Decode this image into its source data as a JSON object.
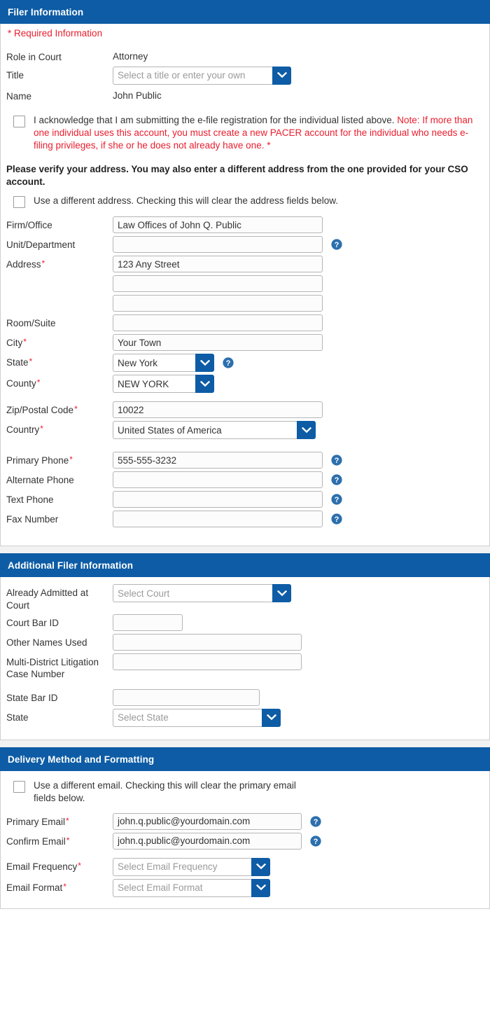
{
  "sections": {
    "filer": {
      "header": "Filer Information",
      "required_note": "* Required Information",
      "role_label": "Role in Court",
      "role_value": "Attorney",
      "title_label": "Title",
      "title_placeholder": "Select a title or enter your own",
      "name_label": "Name",
      "name_value": "John Public",
      "ack_text_1": "I acknowledge that I am submitting the e-file registration for the individual listed above.",
      "ack_text_2": "Note: If more than one individual uses this account, you must create a new PACER account for the individual who needs e-filing privileges, if she or he does not already have one. *",
      "verify_note": "Please verify your address. You may also enter a different address from the one provided for your CSO account.",
      "different_address_text": "Use a different address. Checking this will clear the address fields below.",
      "firm_label": "Firm/Office",
      "firm_value": "Law Offices of John Q. Public",
      "unit_label": "Unit/Department",
      "unit_value": "",
      "address_label": "Address",
      "address_value_1": "123 Any Street",
      "address_value_2": "",
      "address_value_3": "",
      "room_label": "Room/Suite",
      "room_value": "",
      "city_label": "City",
      "city_value": "Your Town",
      "state_label": "State",
      "state_value": "New York",
      "county_label": "County",
      "county_value": "NEW YORK",
      "zip_label": "Zip/Postal Code",
      "zip_value": "10022",
      "country_label": "Country",
      "country_value": "United States of America",
      "primary_phone_label": "Primary Phone",
      "primary_phone_value": "555-555-3232",
      "alternate_phone_label": "Alternate Phone",
      "alternate_phone_value": "",
      "text_phone_label": "Text Phone",
      "text_phone_value": "",
      "fax_label": "Fax Number",
      "fax_value": ""
    },
    "additional": {
      "header": "Additional Filer Information",
      "admitted_label": "Already Admitted at Court",
      "admitted_value": "Select Court",
      "court_bar_label": "Court Bar ID",
      "court_bar_value": "",
      "other_names_label": "Other Names Used",
      "other_names_value": "",
      "mdl_label": "Multi-District Litigation Case Number",
      "mdl_value": "",
      "state_bar_label": "State Bar ID",
      "state_bar_value": "",
      "state_label": "State",
      "state_value": "Select State"
    },
    "delivery": {
      "header": "Delivery Method and Formatting",
      "different_email_text": "Use a different email. Checking this will clear the primary email fields below.",
      "primary_email_label": "Primary Email",
      "primary_email_value": "john.q.public@yourdomain.com",
      "confirm_email_label": "Confirm Email",
      "confirm_email_value": "john.q.public@yourdomain.com",
      "frequency_label": "Email Frequency",
      "frequency_value": "Select Email Frequency",
      "format_label": "Email Format",
      "format_value": "Select Email Format"
    }
  },
  "icons": {
    "help": "help-icon",
    "chevron": "chevron-down-icon"
  },
  "colors": {
    "header_blue": "#0d5ca5",
    "required_red": "#ea1d2d",
    "field_border": "#b5b5b5",
    "help_blue": "#2c6fad"
  }
}
